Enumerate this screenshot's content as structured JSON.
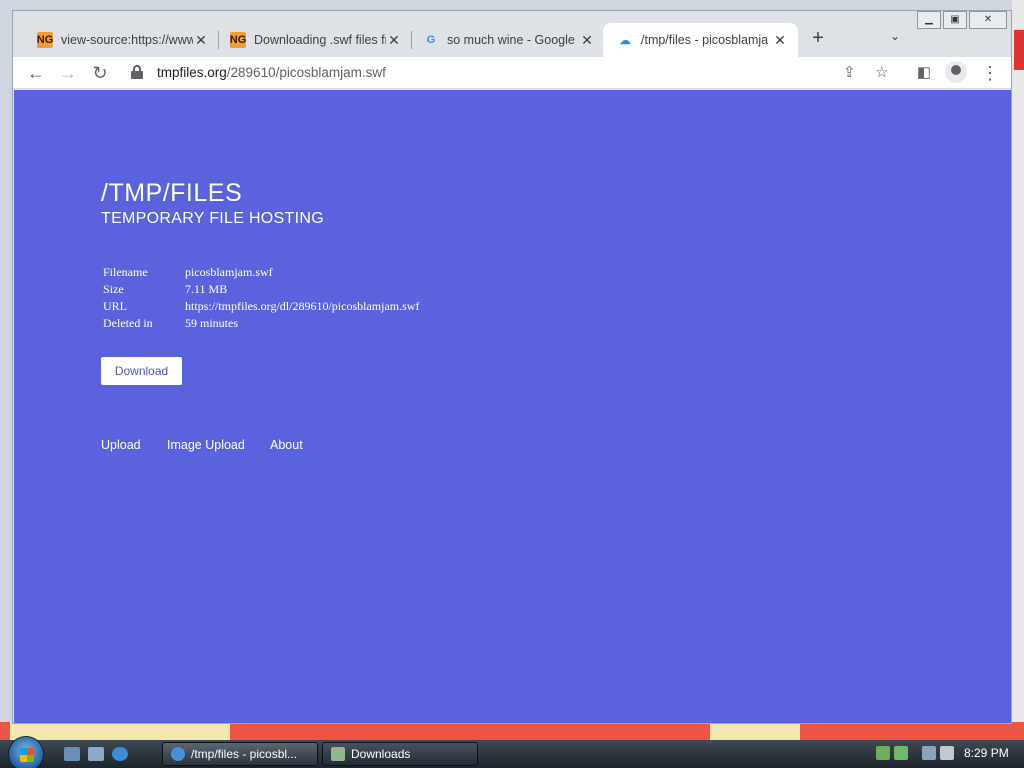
{
  "browser": {
    "tabs": [
      {
        "title": "view-source:https://www.",
        "icon": "newgrounds-icon"
      },
      {
        "title": "Downloading .swf files fr",
        "icon": "newgrounds-icon"
      },
      {
        "title": "so much wine - Google",
        "icon": "google-icon"
      },
      {
        "title": "/tmp/files - picosblamja",
        "icon": "upload-cloud-icon",
        "active": true
      }
    ],
    "url_host": "tmpfiles.org",
    "url_path": "/289610/picosblamjam.swf"
  },
  "page": {
    "title": "/TMP/FILES",
    "subtitle": "TEMPORARY FILE HOSTING",
    "fields": [
      {
        "label": "Filename",
        "value": "picosblamjam.swf"
      },
      {
        "label": "Size",
        "value": "7.11 MB"
      },
      {
        "label": "URL",
        "value": "https://tmpfiles.org/dl/289610/picosblamjam.swf"
      },
      {
        "label": "Deleted in",
        "value": "59 minutes"
      }
    ],
    "download_label": "Download",
    "nav": [
      "Upload",
      "Image Upload",
      "About"
    ],
    "background_color": "#5a63dd"
  },
  "taskbar": {
    "tasks": [
      "/tmp/files - picosbl...",
      "Downloads"
    ],
    "clock": "8:29 PM"
  }
}
